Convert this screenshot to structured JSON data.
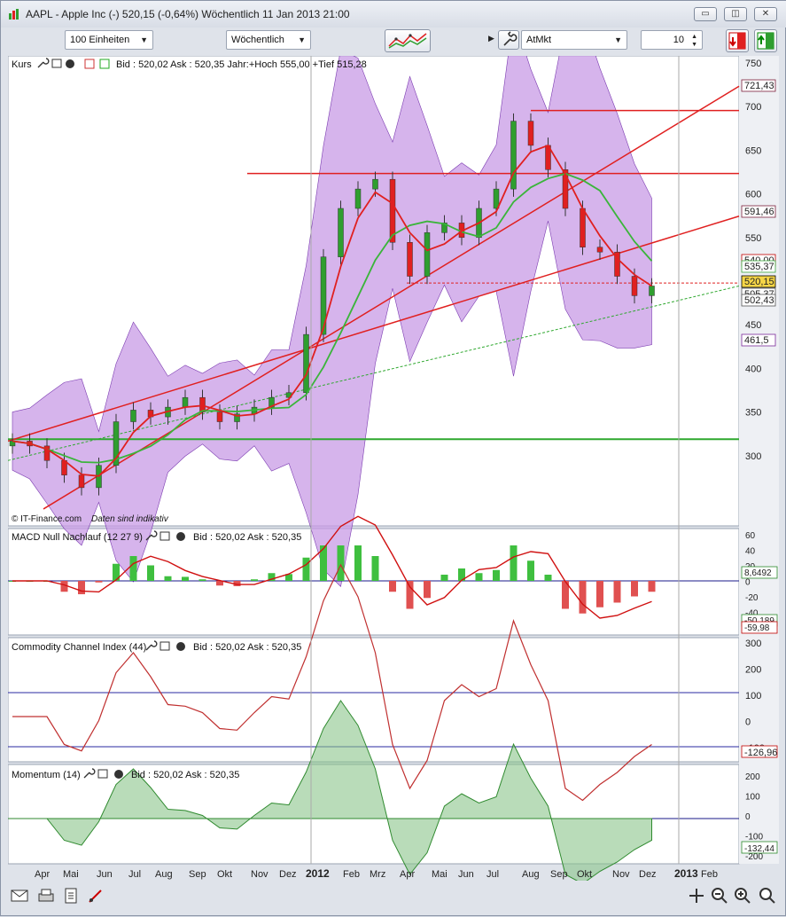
{
  "window": {
    "title": "AAPL - Apple Inc (-)   520,15 (-0,64%)   Wöchentlich  11 Jan 2013 21:00",
    "minimize": "▭",
    "restore": "◫",
    "close": "✕"
  },
  "toolbar": {
    "units": "100 Einheiten",
    "period": "Wöchentlich",
    "order_type": "AtMkt",
    "quantity": "10"
  },
  "panels": {
    "price": {
      "label": "Kurs",
      "info": "Bid : 520,02 Ask : 520,35 Jahr:+Hoch 555,00 +Tief 515,28",
      "watermark_brand": "© IT-Finance.com",
      "watermark_note": "Daten sind indikativ",
      "y_ticks": [
        "750",
        "700",
        "650",
        "600",
        "550",
        "500",
        "450",
        "400",
        "350",
        "300"
      ],
      "badges": [
        {
          "text": "721,43",
          "color": "#7a1f3a"
        },
        {
          "text": "591,46",
          "color": "#7a1f3a"
        },
        {
          "text": "540,00",
          "color": "#c00000"
        },
        {
          "text": "535,37",
          "color": "#3aa63a"
        },
        {
          "text": "520,15",
          "color": "#000000"
        },
        {
          "text": "505,37",
          "color": "#555555"
        },
        {
          "text": "502,43",
          "color": "#555555"
        },
        {
          "text": "461,5",
          "color": "#7a2a9a"
        }
      ]
    },
    "macd": {
      "label": "MACD Null Nachlauf (12 27 9)",
      "info": "Bid : 520,02 Ask : 520,35",
      "y_ticks": [
        "60",
        "40",
        "20",
        "0",
        "-20",
        "-40",
        "-60"
      ],
      "badges": [
        {
          "text": "8,6492",
          "color": "#2b8a2b"
        },
        {
          "text": "-50,189",
          "color": "#2b8a2b"
        },
        {
          "text": "-59,98",
          "color": "#c00000"
        }
      ]
    },
    "cci": {
      "label": "Commodity Channel Index (44)",
      "info": "Bid : 520,02 Ask : 520,35",
      "y_ticks": [
        "300",
        "200",
        "100",
        "0",
        "-100"
      ],
      "badges": [
        {
          "text": "-126,96",
          "color": "#c00000"
        }
      ]
    },
    "momentum": {
      "label": "Momentum (14)",
      "info": "Bid : 520,02 Ask : 520,35",
      "y_ticks": [
        "200",
        "100",
        "0",
        "-100",
        "-200"
      ],
      "badges": [
        {
          "text": "-132,44",
          "color": "#2b8a2b"
        }
      ]
    }
  },
  "x_axis": [
    "Apr",
    "Mai",
    "Jun",
    "Jul",
    "Aug",
    "Sep",
    "Okt",
    "Nov",
    "Dez",
    "2012",
    "Feb",
    "Mrz",
    "Apr",
    "Mai",
    "Jun",
    "Jul",
    "Aug",
    "Sep",
    "Okt",
    "Nov",
    "Dez",
    "2013",
    "Feb"
  ],
  "colors": {
    "band_fill": "#c89be6",
    "up_candle": "#2f9e2f",
    "down_candle": "#e02020",
    "ma_fast": "#e02020",
    "ma_slow": "#3ab53a",
    "support": "#2fa82f",
    "resistance": "#e02020"
  },
  "chart_data": {
    "type": "line",
    "series": [
      {
        "name": "Kurs",
        "values": [
          360,
          355,
          340,
          325,
          312,
          335,
          380,
          392,
          385,
          395,
          405,
          390,
          380,
          388,
          395,
          405,
          410,
          470,
          550,
          600,
          620,
          630,
          565,
          530,
          575,
          585,
          570,
          600,
          620,
          690,
          665,
          640,
          600,
          560,
          555,
          530,
          510,
          520
        ]
      }
    ],
    "ylim": [
      290,
      760
    ]
  }
}
